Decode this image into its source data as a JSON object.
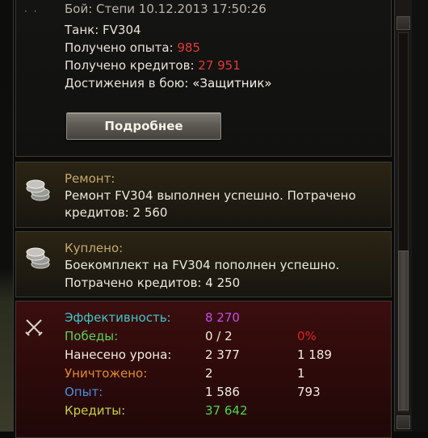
{
  "battle": {
    "partial_line": "Бой: Степи 10.12.2013 17:50:26",
    "tank_line": "Танк: FV304",
    "xp_label": "Получено опыта: ",
    "xp_value": "985",
    "credits_label": "Получено кредитов: ",
    "credits_value": "27 951",
    "achievements_label": "Достижения в бою: ",
    "achievements_value": "«Защитник»",
    "details_button": "Подробнее"
  },
  "repair": {
    "title": "Ремонт:",
    "line1": "Ремонт FV304 выполнен успешно. Потрачено",
    "line2": "кредитов:  2 560"
  },
  "purchase": {
    "title": "Куплено:",
    "line1": "Боекомплект на FV304 пополнен успешно.",
    "line2": "Потрачено кредитов:  4 250"
  },
  "stats": {
    "rows": [
      {
        "label": "Эффективность:",
        "v1": "8 270",
        "v2": "",
        "color": "#3ec8c8",
        "v1_color": "#c050e8",
        "v2_color": ""
      },
      {
        "label": "Победы:",
        "v1": "0 / 2",
        "v2": "0%",
        "color": "#5ad25a",
        "v1_color": "#f0ece0",
        "v2_color": "#e02020"
      },
      {
        "label": "Нанесено урона:",
        "v1": "2 377",
        "v2": "1 189",
        "color": "#f0ece0",
        "v1_color": "#f0ece0",
        "v2_color": "#f0ece0"
      },
      {
        "label": "Уничтожено:",
        "v1": "2",
        "v2": "1",
        "color": "#e08a28",
        "v1_color": "#f0ece0",
        "v2_color": "#f0ece0"
      },
      {
        "label": "Опыт:",
        "v1": "1 586",
        "v2": "793",
        "color": "#4a90e0",
        "v1_color": "#f0ece0",
        "v2_color": "#f0ece0"
      },
      {
        "label": "Кредиты:",
        "v1": "37 642",
        "v2": "",
        "color": "#c8d040",
        "v1_color": "#4ad84a",
        "v2_color": ""
      }
    ]
  },
  "colors": {
    "highlight_red": "#e03a3a",
    "title_yellow": "#c6a96a"
  },
  "icons": {
    "coins": "coins-icon",
    "crossed_swords": "crossed-swords-icon"
  }
}
